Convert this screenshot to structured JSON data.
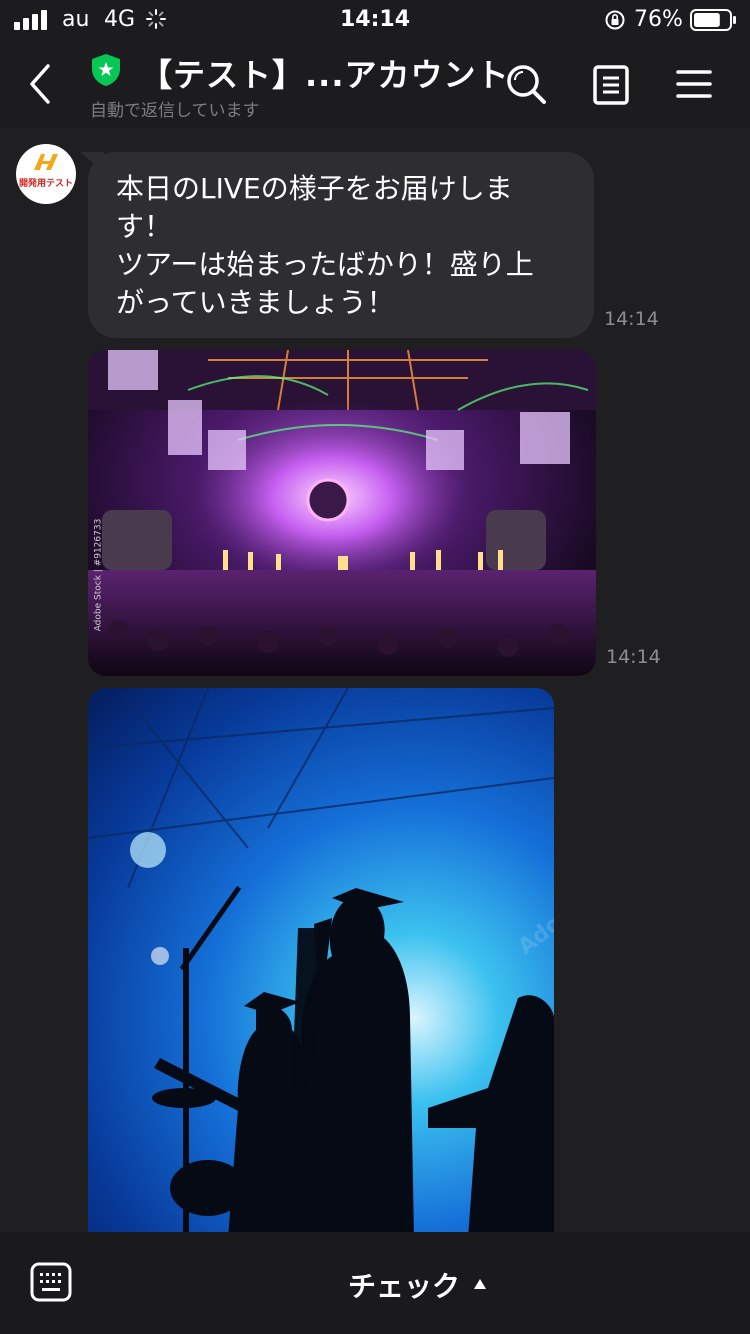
{
  "status": {
    "carrier": "au",
    "network": "4G",
    "time": "14:14",
    "battery": "76%",
    "battery_level": 0.76,
    "icons": [
      "signal-icon",
      "spinner-icon",
      "rotation-lock-icon",
      "battery-icon"
    ]
  },
  "header": {
    "title": "【テスト】...アカウント",
    "subtitle": "自動で返信しています",
    "icons": [
      "back-icon",
      "shield-icon",
      "search-icon",
      "notes-icon",
      "menu-icon"
    ],
    "shield_color": "#06c755"
  },
  "chat": {
    "avatar_text": "開発用テスト",
    "message": {
      "lines": [
        "本日のLIVEの様子をお届けしま",
        "す！",
        "ツアーは始まったばかり！盛り上",
        "がっていきましょう！"
      ],
      "time": "14:14"
    },
    "photo1": {
      "credit": "Adobe Stock | #9126733",
      "time": "14:14"
    },
    "photo2": {
      "watermark": "Adobe Stock"
    }
  },
  "footer": {
    "label": "チェック",
    "icons": [
      "keyboard-icon",
      "caret-up-icon"
    ]
  },
  "colors": {
    "background": "#1f1f21",
    "bubble": "#2e2e30",
    "accent_green": "#06c755"
  }
}
